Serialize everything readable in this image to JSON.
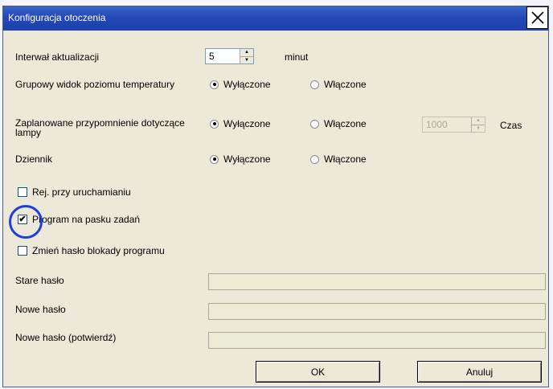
{
  "window": {
    "title": "Konfiguracja otoczenia"
  },
  "rows": {
    "interval": {
      "label": "Interwał aktualizacji",
      "value": "5",
      "unit": "minut"
    },
    "group_view": {
      "label": "Grupowy widok poziomu temperatury",
      "option_off": "Wyłączone",
      "option_on": "Włączone",
      "selected": "Wyłączone"
    },
    "lamp_reminder": {
      "label": "Zaplanowane przypomnienie dotyczące lampy",
      "option_off": "Wyłączone",
      "option_on": "Włączone",
      "selected": "Wyłączone",
      "hours_value": "1000",
      "hours_unit": "Czas"
    },
    "log": {
      "label": "Dziennik",
      "option_off": "Wyłączone",
      "option_on": "Włączone",
      "selected": "Wyłączone"
    }
  },
  "checkboxes": {
    "startup_log": {
      "label": "Rej. przy uruchamianiu",
      "checked": false
    },
    "taskbar": {
      "label": "Program na pasku zadań",
      "checked": true
    },
    "change_password": {
      "label": "Zmień hasło blokady programu",
      "checked": false
    }
  },
  "passwords": {
    "old": {
      "label": "Stare hasło",
      "value": ""
    },
    "new": {
      "label": "Nowe hasło",
      "value": ""
    },
    "confirm": {
      "label": "Nowe hasło (potwierdź)",
      "value": ""
    }
  },
  "buttons": {
    "ok": "OK",
    "cancel": "Anuluj"
  },
  "icons": {
    "close": "close-icon",
    "spin_up": "arrow-up-icon",
    "spin_down": "arrow-down-icon"
  },
  "colors": {
    "titlebar": "#2249b8",
    "highlight_circle": "#1d3fe0",
    "dialog_bg": "#ece9d8"
  }
}
